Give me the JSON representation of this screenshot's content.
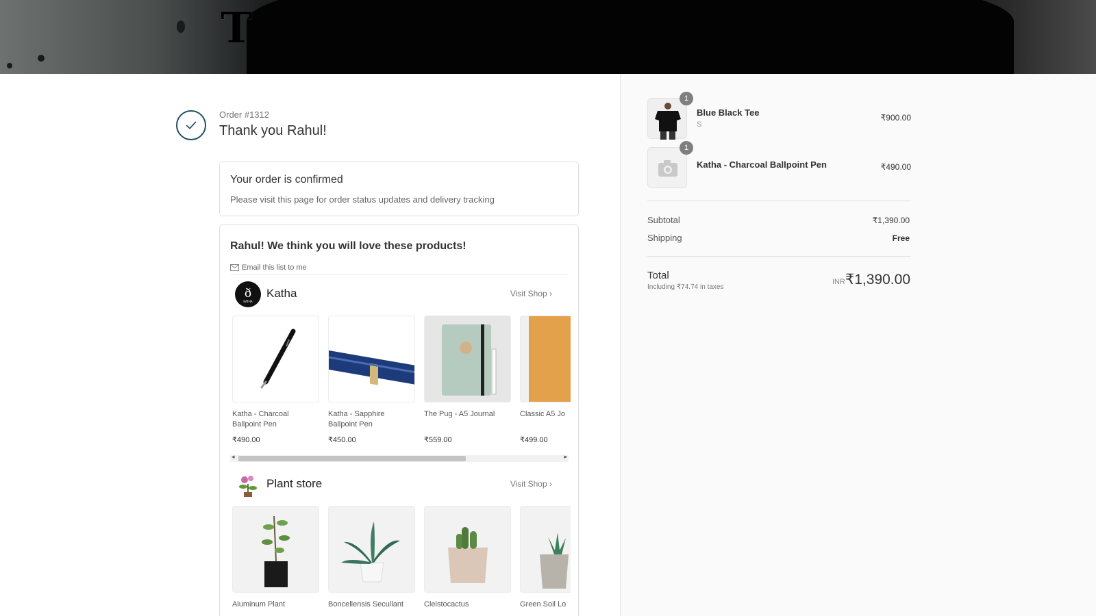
{
  "header": {
    "logo_text": "T"
  },
  "order": {
    "number": "Order #1312",
    "thank_you": "Thank you Rahul!",
    "confirm_title": "Your order is confirmed",
    "confirm_sub": "Please visit this page for order status updates and delivery tracking"
  },
  "recommendations": {
    "title": "Rahul! We think you will love these products!",
    "email_link": "Email this list to me",
    "shops": [
      {
        "name": "Katha",
        "visit_label": "Visit Shop",
        "products": [
          {
            "name": "Katha - Charcoal Ballpoint Pen",
            "price": "₹490.00"
          },
          {
            "name": "Katha - Sapphire Ballpoint Pen",
            "price": "₹450.00"
          },
          {
            "name": "The Pug - A5 Journal",
            "price": "₹559.00"
          },
          {
            "name": "Classic A5 Jo",
            "price": "₹499.00"
          }
        ]
      },
      {
        "name": "Plant store",
        "visit_label": "Visit Shop",
        "products": [
          {
            "name": "Aluminum Plant",
            "price": ""
          },
          {
            "name": "Boncellensis Secullant",
            "price": ""
          },
          {
            "name": "Cleistocactus",
            "price": ""
          },
          {
            "name": "Green Soil Lo",
            "price": ""
          }
        ]
      }
    ]
  },
  "summary": {
    "items": [
      {
        "name": "Blue Black Tee",
        "variant": "S",
        "price": "₹900.00",
        "qty": "1"
      },
      {
        "name": "Katha - Charcoal Ballpoint Pen",
        "variant": "",
        "price": "₹490.00",
        "qty": "1"
      }
    ],
    "subtotal_label": "Subtotal",
    "subtotal_value": "₹1,390.00",
    "shipping_label": "Shipping",
    "shipping_value": "Free",
    "total_label": "Total",
    "tax_note": "Including ₹74.74 in taxes",
    "currency": "INR",
    "total_value": "₹1,390.00"
  },
  "colors": {
    "accent": "#1f4e5c",
    "badge": "#7f7f7f"
  }
}
